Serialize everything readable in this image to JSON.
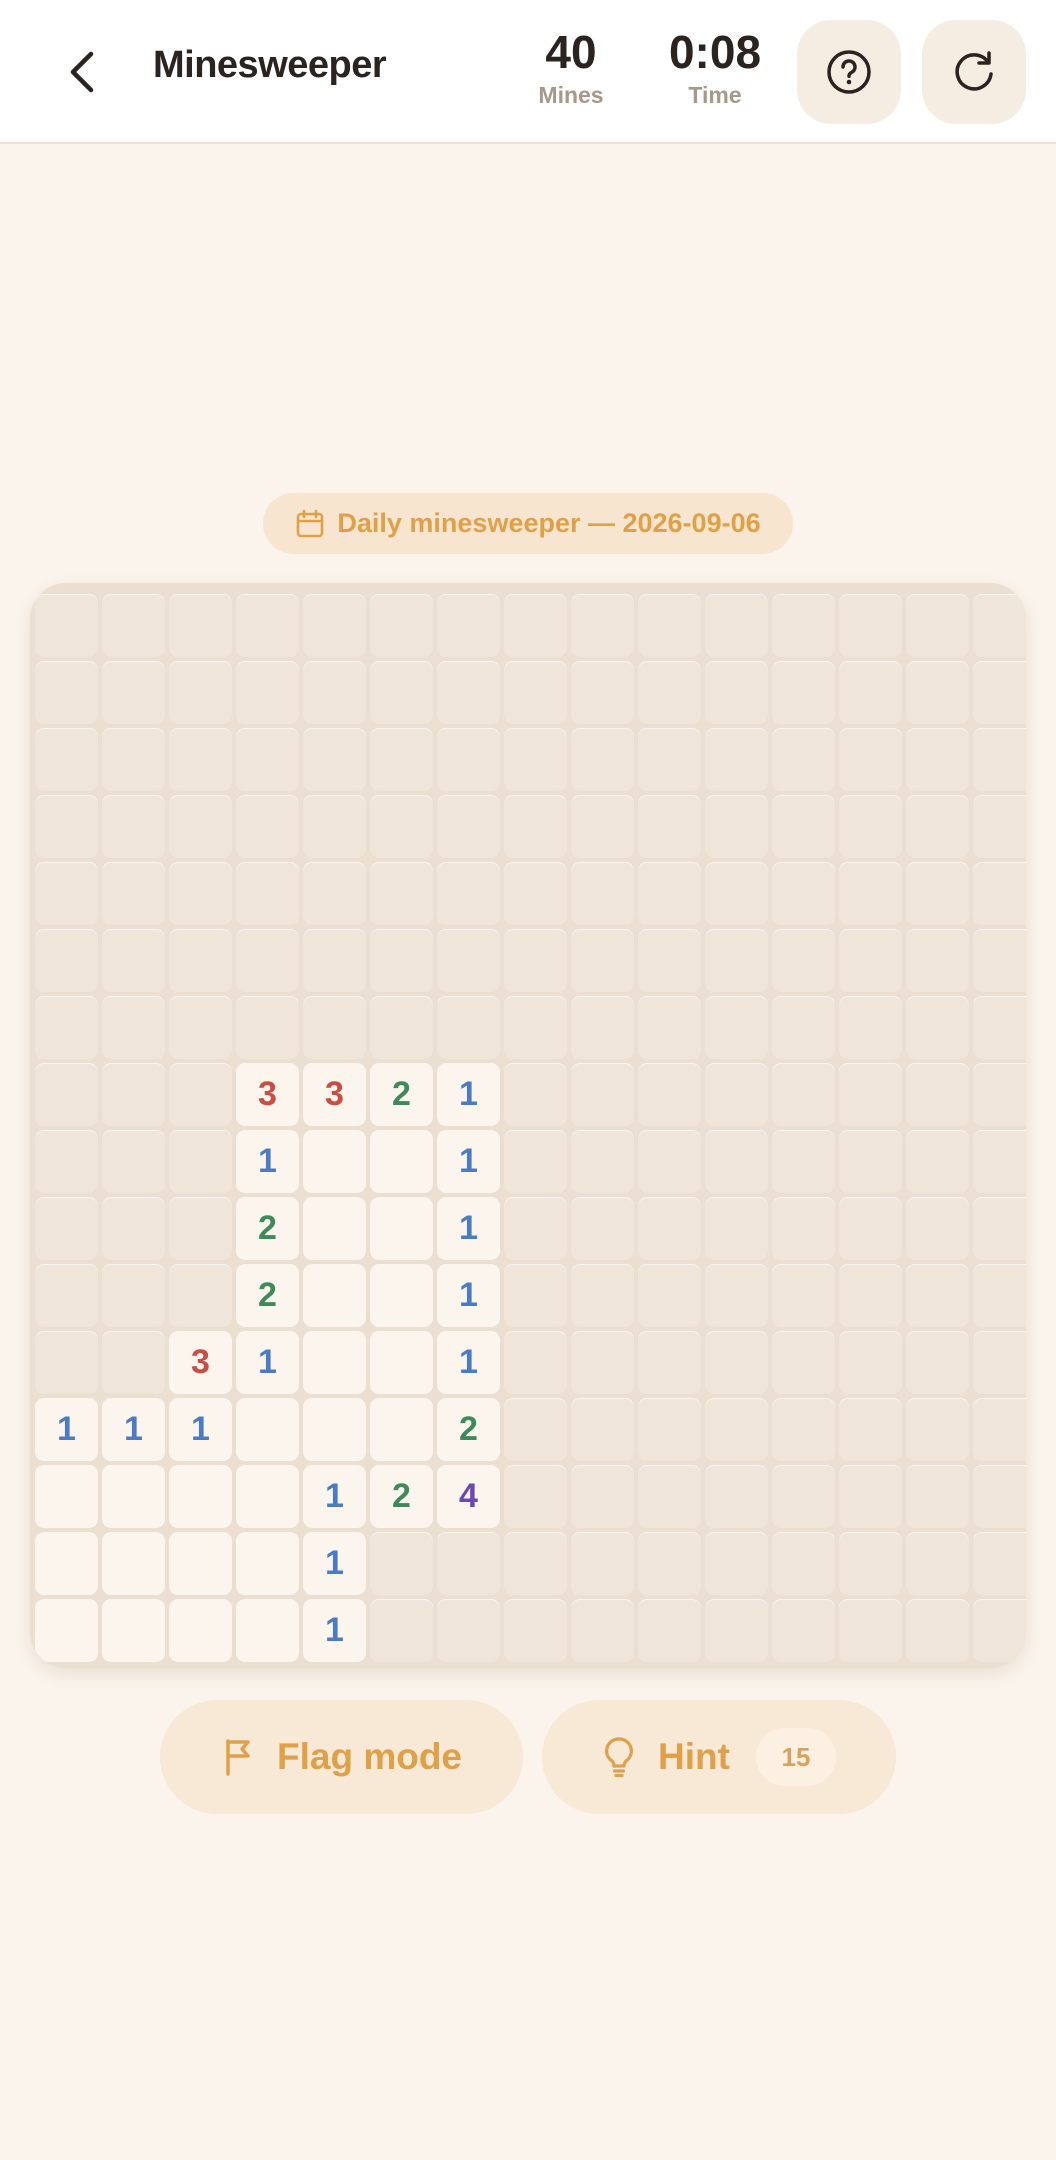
{
  "header": {
    "title": "Minesweeper",
    "mines": {
      "value": "40",
      "label": "Mines"
    },
    "time": {
      "value": "0:08",
      "label": "Time"
    }
  },
  "daily": {
    "label": "Daily minesweeper — 2026-09-06"
  },
  "board": {
    "legend": "H = unrevealed cell, 0 = revealed empty, 1-8 = revealed number",
    "rows": [
      [
        "H",
        "H",
        "H",
        "H",
        "H",
        "H",
        "H",
        "H",
        "H",
        "H",
        "H",
        "H",
        "H",
        "H",
        "H"
      ],
      [
        "H",
        "H",
        "H",
        "H",
        "H",
        "H",
        "H",
        "H",
        "H",
        "H",
        "H",
        "H",
        "H",
        "H",
        "H"
      ],
      [
        "H",
        "H",
        "H",
        "H",
        "H",
        "H",
        "H",
        "H",
        "H",
        "H",
        "H",
        "H",
        "H",
        "H",
        "H"
      ],
      [
        "H",
        "H",
        "H",
        "H",
        "H",
        "H",
        "H",
        "H",
        "H",
        "H",
        "H",
        "H",
        "H",
        "H",
        "H"
      ],
      [
        "H",
        "H",
        "H",
        "H",
        "H",
        "H",
        "H",
        "H",
        "H",
        "H",
        "H",
        "H",
        "H",
        "H",
        "H"
      ],
      [
        "H",
        "H",
        "H",
        "H",
        "H",
        "H",
        "H",
        "H",
        "H",
        "H",
        "H",
        "H",
        "H",
        "H",
        "H"
      ],
      [
        "H",
        "H",
        "H",
        "H",
        "H",
        "H",
        "H",
        "H",
        "H",
        "H",
        "H",
        "H",
        "H",
        "H",
        "H"
      ],
      [
        "H",
        "H",
        "H",
        "3",
        "3",
        "2",
        "1",
        "H",
        "H",
        "H",
        "H",
        "H",
        "H",
        "H",
        "H"
      ],
      [
        "H",
        "H",
        "H",
        "1",
        "0",
        "0",
        "1",
        "H",
        "H",
        "H",
        "H",
        "H",
        "H",
        "H",
        "H"
      ],
      [
        "H",
        "H",
        "H",
        "2",
        "0",
        "0",
        "1",
        "H",
        "H",
        "H",
        "H",
        "H",
        "H",
        "H",
        "H"
      ],
      [
        "H",
        "H",
        "H",
        "2",
        "0",
        "0",
        "1",
        "H",
        "H",
        "H",
        "H",
        "H",
        "H",
        "H",
        "H"
      ],
      [
        "H",
        "H",
        "3",
        "1",
        "0",
        "0",
        "1",
        "H",
        "H",
        "H",
        "H",
        "H",
        "H",
        "H",
        "H"
      ],
      [
        "1",
        "1",
        "1",
        "0",
        "0",
        "0",
        "2",
        "H",
        "H",
        "H",
        "H",
        "H",
        "H",
        "H",
        "H"
      ],
      [
        "0",
        "0",
        "0",
        "0",
        "1",
        "2",
        "4",
        "H",
        "H",
        "H",
        "H",
        "H",
        "H",
        "H",
        "H"
      ],
      [
        "0",
        "0",
        "0",
        "0",
        "1",
        "H",
        "H",
        "H",
        "H",
        "H",
        "H",
        "H",
        "H",
        "H",
        "H"
      ],
      [
        "0",
        "0",
        "0",
        "0",
        "1",
        "H",
        "H",
        "H",
        "H",
        "H",
        "H",
        "H",
        "H",
        "H",
        "H"
      ]
    ]
  },
  "actions": {
    "flag_label": "Flag mode",
    "hint_label": "Hint",
    "hint_count": "15"
  },
  "icons": {
    "back": "chevron-left-icon",
    "help": "question-circle-icon",
    "restart": "restart-icon",
    "calendar": "calendar-icon",
    "flag": "flag-icon",
    "hint": "lightbulb-icon"
  },
  "colors": {
    "accent": "#e0a048",
    "number_1": "#4a7bc4",
    "number_2": "#3f8a5a",
    "number_3": "#cc4c42",
    "number_4": "#6a4ab0"
  }
}
